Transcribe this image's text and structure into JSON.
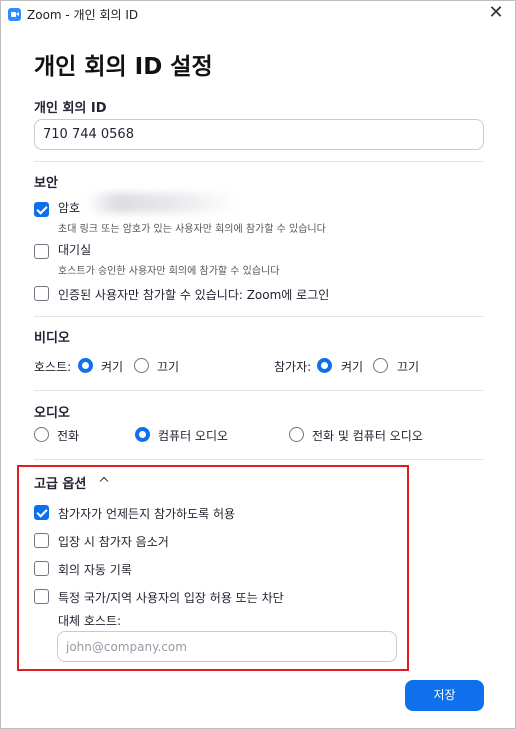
{
  "window": {
    "title": "Zoom - 개인 회의 ID"
  },
  "heading": "개인 회의 ID 설정",
  "meeting_id": {
    "label": "개인 회의 ID",
    "value": "710 744 0568"
  },
  "security": {
    "label": "보안",
    "passcode": {
      "label": "암호",
      "desc": "초대 링크 또는 암호가 있는 사용자만 회의에 참가할 수 있습니다",
      "checked": true
    },
    "waiting_room": {
      "label": "대기실",
      "desc": "호스트가 승인한 사용자만 회의에 참가할 수 있습니다",
      "checked": false
    },
    "auth": {
      "label": "인증된 사용자만 참가할 수 있습니다: Zoom에 로그인",
      "checked": false
    }
  },
  "video": {
    "label": "비디오",
    "host_label": "호스트:",
    "participant_label": "참가자:",
    "on": "켜기",
    "off": "끄기",
    "host_value": "켜기",
    "participant_value": "켜기"
  },
  "audio": {
    "label": "오디오",
    "options": [
      "전화",
      "컴퓨터 오디오",
      "전화 및 컴퓨터 오디오"
    ],
    "selected": "컴퓨터 오디오"
  },
  "advanced": {
    "label": "고급 옵션",
    "join_anytime": {
      "label": "참가자가 언제든지 참가하도록 허용",
      "checked": true
    },
    "mute_on_entry": {
      "label": "입장 시 참가자 음소거",
      "checked": false
    },
    "auto_record": {
      "label": "회의 자동 기록",
      "checked": false
    },
    "region_block": {
      "label": "특정 국가/지역 사용자의 입장 허용 또는 차단",
      "checked": false
    },
    "alt_host_label": "대체 호스트:",
    "alt_host_placeholder": "john@company.com"
  },
  "save_label": "저장",
  "colors": {
    "accent": "#0e71eb",
    "highlight": "#e01c1c"
  }
}
